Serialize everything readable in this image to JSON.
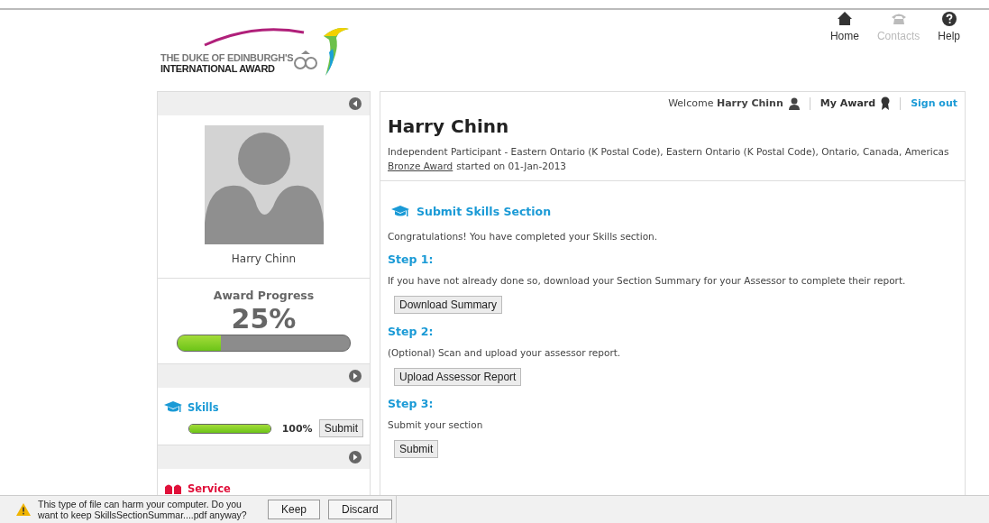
{
  "header": {
    "logo_lines": [
      "THE DUKE OF EDINBURGH'S",
      "INTERNATIONAL AWARD"
    ],
    "nav": [
      {
        "kind": "home",
        "label": "Home",
        "disabled": false
      },
      {
        "kind": "contacts",
        "label": "Contacts",
        "disabled": true
      },
      {
        "kind": "help",
        "label": "Help",
        "disabled": false
      }
    ]
  },
  "sidebar": {
    "profile_name": "Harry Chinn",
    "progress": {
      "title": "Award Progress",
      "reading": "25%",
      "level": 0.25
    },
    "sections": [
      {
        "kind": "skills",
        "name": "Skills",
        "color": "#1a9ad6",
        "level": 1,
        "reading": "100%",
        "button": "Submit"
      },
      {
        "kind": "service",
        "name": "Service",
        "color": "#e0103a"
      }
    ]
  },
  "main": {
    "topbar": {
      "welcome": "Welcome **Harry Chinn**",
      "my_award": "My Award",
      "sign_out": "Sign out"
    },
    "title": "Harry Chinn",
    "description": "Independent Participant - Eastern Ontario (K Postal Code), Eastern Ontario (K Postal Code), Ontario, Canada, Americas",
    "award_link": "Bronze Award",
    "award_text": "started on 01-Jan-2013",
    "section_title": "Submit Skills Section",
    "intro": "Congratulations! You have completed your Skills section.",
    "steps": [
      {
        "heading": "Step 1:",
        "text": "If you have not already done so, download your Section Summary for your Assessor to complete their report.",
        "button": "Download Summary"
      },
      {
        "heading": "Step 2:",
        "text": "(Optional) Scan and upload your assessor report.",
        "button": "Upload Assessor Report"
      },
      {
        "heading": "Step 3:",
        "text": "Submit your section",
        "button": "Submit"
      }
    ]
  },
  "download_bar": {
    "message": "This type of file can harm your computer. Do you want to keep SkillsSectionSummar....pdf anyway?",
    "buttons": [
      "Keep",
      "Discard"
    ]
  }
}
